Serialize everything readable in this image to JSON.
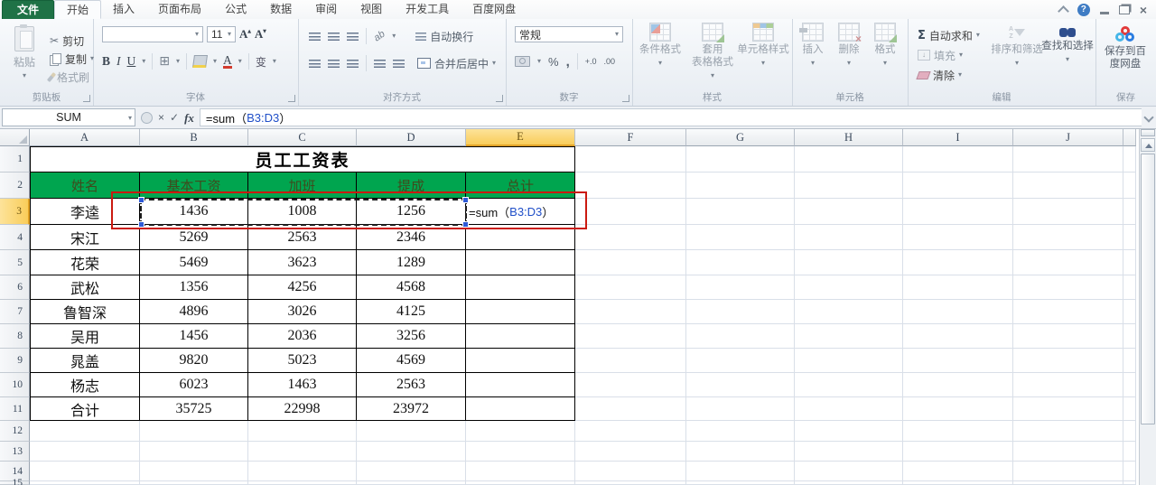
{
  "menubar": {
    "tabs": [
      "文件",
      "开始",
      "插入",
      "页面布局",
      "公式",
      "数据",
      "审阅",
      "视图",
      "开发工具",
      "百度网盘"
    ],
    "active_tab": "开始"
  },
  "ribbon": {
    "clipboard": {
      "label": "剪贴板",
      "paste": "粘贴",
      "cut": "剪切",
      "copy": "复制",
      "format_painter": "格式刷"
    },
    "font": {
      "label": "字体",
      "size": "11"
    },
    "alignment": {
      "label": "对齐方式",
      "wrap_text": "自动换行",
      "merge_center": "合并后居中"
    },
    "number": {
      "label": "数字",
      "format": "常规"
    },
    "styles": {
      "label": "样式",
      "conditional": "条件格式",
      "format_as_table_l1": "套用",
      "format_as_table_l2": "表格格式",
      "cell_styles": "单元格样式"
    },
    "cells": {
      "label": "单元格",
      "insert": "插入",
      "delete": "删除",
      "format": "格式"
    },
    "editing": {
      "label": "编辑",
      "autosum": "自动求和",
      "fill": "填充",
      "clear": "清除",
      "sort_filter": "排序和筛选",
      "find_select": "查找和选择"
    },
    "save": {
      "label": "保存",
      "baidu_l1": "保存到百",
      "baidu_l2": "度网盘"
    }
  },
  "formula_bar": {
    "name_box": "SUM",
    "formula_prefix": "=sum（",
    "formula_ref": "B3:D3",
    "formula_suffix": "）"
  },
  "sheet": {
    "title": "员工工资表",
    "columns": [
      "A",
      "B",
      "C",
      "D",
      "E",
      "F",
      "G",
      "H",
      "I",
      "J"
    ],
    "visible_rows": 15,
    "selected_column": "E",
    "selected_row": 3,
    "table": {
      "headers": [
        "姓名",
        "基本工资",
        "加班",
        "提成",
        "总计"
      ],
      "data": [
        [
          "李逵",
          "1436",
          "1008",
          "1256",
          {
            "prefix": "=sum（",
            "ref": "B3:D3",
            "suffix": "）"
          }
        ],
        [
          "宋江",
          "5269",
          "2563",
          "2346",
          ""
        ],
        [
          "花荣",
          "5469",
          "3623",
          "1289",
          ""
        ],
        [
          "武松",
          "1356",
          "4256",
          "4568",
          ""
        ],
        [
          "鲁智深",
          "4896",
          "3026",
          "4125",
          ""
        ],
        [
          "吴用",
          "1456",
          "2036",
          "3256",
          ""
        ],
        [
          "晁盖",
          "9820",
          "5023",
          "4569",
          ""
        ],
        [
          "杨志",
          "6023",
          "1463",
          "2563",
          ""
        ],
        [
          "合计",
          "35725",
          "22998",
          "23972",
          ""
        ]
      ]
    },
    "colors": {
      "header_green": "#00a54f",
      "selection_yellow": "#fbd05e",
      "annotation_red": "#cb1a10",
      "formula_ref_blue": "#1f4ec8",
      "file_tab_green": "#1f7246"
    }
  }
}
